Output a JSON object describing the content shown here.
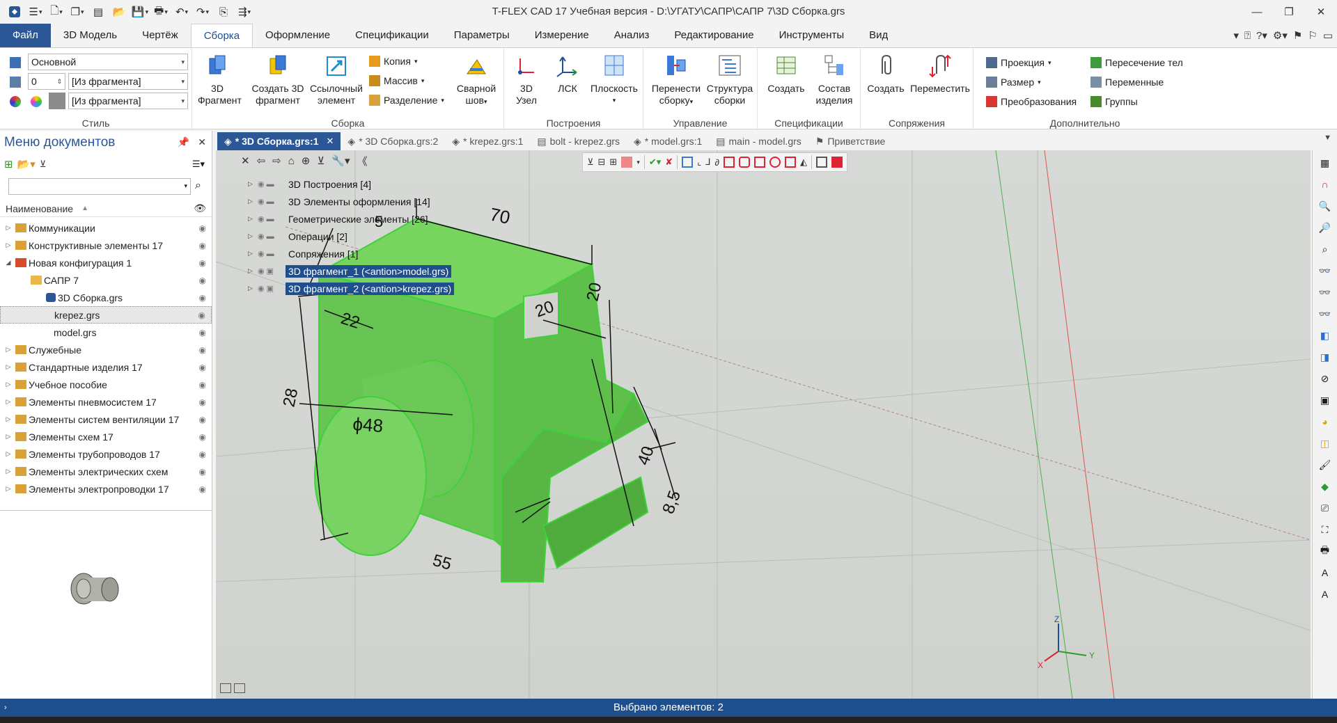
{
  "window": {
    "title": "T-FLEX CAD 17 Учебная версия - D:\\УГАТУ\\САПР\\САПР 7\\3D Сборка.grs",
    "controls": [
      "minimize-icon",
      "restore-icon",
      "close-icon"
    ]
  },
  "ribbon_tabs": [
    "Файл",
    "3D Модель",
    "Чертёж",
    "Сборка",
    "Оформление",
    "Спецификации",
    "Параметры",
    "Измерение",
    "Анализ",
    "Редактирование",
    "Инструменты",
    "Вид"
  ],
  "active_tab": "Сборка",
  "style_group": {
    "label": "Стиль",
    "layer_value": "Основной",
    "level_value": "0",
    "level_from": "[Из фрагмента]",
    "color_from": "[Из фрагмента]"
  },
  "assembly_group": {
    "label": "Сборка",
    "btn_3d_fragment": [
      "3D",
      "Фрагмент"
    ],
    "btn_create_3d_fragment": [
      "Создать 3D",
      "фрагмент"
    ],
    "btn_ref_element": [
      "Ссылочный",
      "элемент"
    ],
    "copy": "Копия",
    "array": "Массив",
    "split": "Разделение",
    "btn_weld": [
      "Сварной",
      "шов"
    ]
  },
  "build_group": {
    "label": "Построения",
    "btn_node": [
      "3D",
      "Узел"
    ],
    "btn_lsk": "ЛСК",
    "btn_plane": "Плоскость"
  },
  "control_group": {
    "label": "Управление",
    "btn_move_assembly": [
      "Перенести",
      "сборку"
    ],
    "btn_structure": [
      "Структура",
      "сборки"
    ]
  },
  "spec_group": {
    "label": "Спецификации",
    "btn_create": "Создать",
    "btn_composition": [
      "Состав",
      "изделия"
    ]
  },
  "mates_group": {
    "label": "Сопряжения",
    "btn_create": "Создать",
    "btn_move": "Переместить"
  },
  "extra_group": {
    "label": "Дополнительно",
    "projection": "Проекция",
    "size": "Размер",
    "transforms": "Преобразования",
    "intersection": "Пересечение тел",
    "variables": "Переменные",
    "groups": "Группы"
  },
  "doc_tabs": [
    {
      "label": "* 3D Сборка.grs:1",
      "active": true
    },
    {
      "label": "* 3D Сборка.grs:2",
      "active": false
    },
    {
      "label": "* krepez.grs:1",
      "active": false
    },
    {
      "label": "bolt - krepez.grs",
      "active": false
    },
    {
      "label": "* model.grs:1",
      "active": false
    },
    {
      "label": "main - model.grs",
      "active": false
    },
    {
      "label": "Приветствие",
      "active": false
    }
  ],
  "left_panel": {
    "title": "Меню документов",
    "column_header": "Наименование",
    "items": [
      {
        "label": "Коммуникации",
        "level": 0,
        "expander": "▷"
      },
      {
        "label": "Конструктивные элементы 17",
        "level": 0,
        "expander": "▷"
      },
      {
        "label": "Новая конфигурация 1",
        "level": 0,
        "expander": "◢"
      },
      {
        "label": "САПР 7",
        "level": 1,
        "expander": ""
      },
      {
        "label": "3D Сборка.grs",
        "level": 2,
        "expander": ""
      },
      {
        "label": "krepez.grs",
        "level": 2,
        "expander": "",
        "selected": true
      },
      {
        "label": "model.grs",
        "level": 2,
        "expander": ""
      },
      {
        "label": "Служебные",
        "level": 0,
        "expander": "▷"
      },
      {
        "label": "Стандартные изделия 17",
        "level": 0,
        "expander": "▷"
      },
      {
        "label": "Учебное пособие",
        "level": 0,
        "expander": "▷"
      },
      {
        "label": "Элементы пневмосистем 17",
        "level": 0,
        "expander": "▷"
      },
      {
        "label": "Элементы систем вентиляции 17",
        "level": 0,
        "expander": "▷"
      },
      {
        "label": "Элементы схем 17",
        "level": 0,
        "expander": "▷"
      },
      {
        "label": "Элементы трубопроводов 17",
        "level": 0,
        "expander": "▷"
      },
      {
        "label": "Элементы электрических схем",
        "level": 0,
        "expander": "▷"
      },
      {
        "label": "Элементы электропроводки 17",
        "level": 0,
        "expander": "▷"
      }
    ]
  },
  "model_tree": {
    "items": [
      {
        "label": "3D Построения [4]",
        "selected": false
      },
      {
        "label": "3D Элементы оформления [14]",
        "selected": false
      },
      {
        "label": "Геометрические элементы [26]",
        "selected": false
      },
      {
        "label": "Операции [2]",
        "selected": false
      },
      {
        "label": "Сопряжения [1]",
        "selected": false
      },
      {
        "label": "3D фрагмент_1 (<antion>model.grs)",
        "selected": true
      },
      {
        "label": "3D фрагмент_2 (<antion>krepez.grs)",
        "selected": true
      }
    ]
  },
  "dimensions": {
    "d70": "70",
    "d28": "28",
    "d22": "22",
    "d20a": "20",
    "d20b": "20",
    "d40": "40",
    "d8_5": "8,5",
    "d48": "ϕ48",
    "d55": "55",
    "d5": "5"
  },
  "axes": {
    "z": "Z",
    "x": "X",
    "y": "Y"
  },
  "status": {
    "message": "Выбрано элементов: 2"
  },
  "colors": {
    "accent": "#2b5797",
    "model_green": "#6fcf57",
    "model_edge": "#3fd13a",
    "selection": "#1f4e8c"
  }
}
